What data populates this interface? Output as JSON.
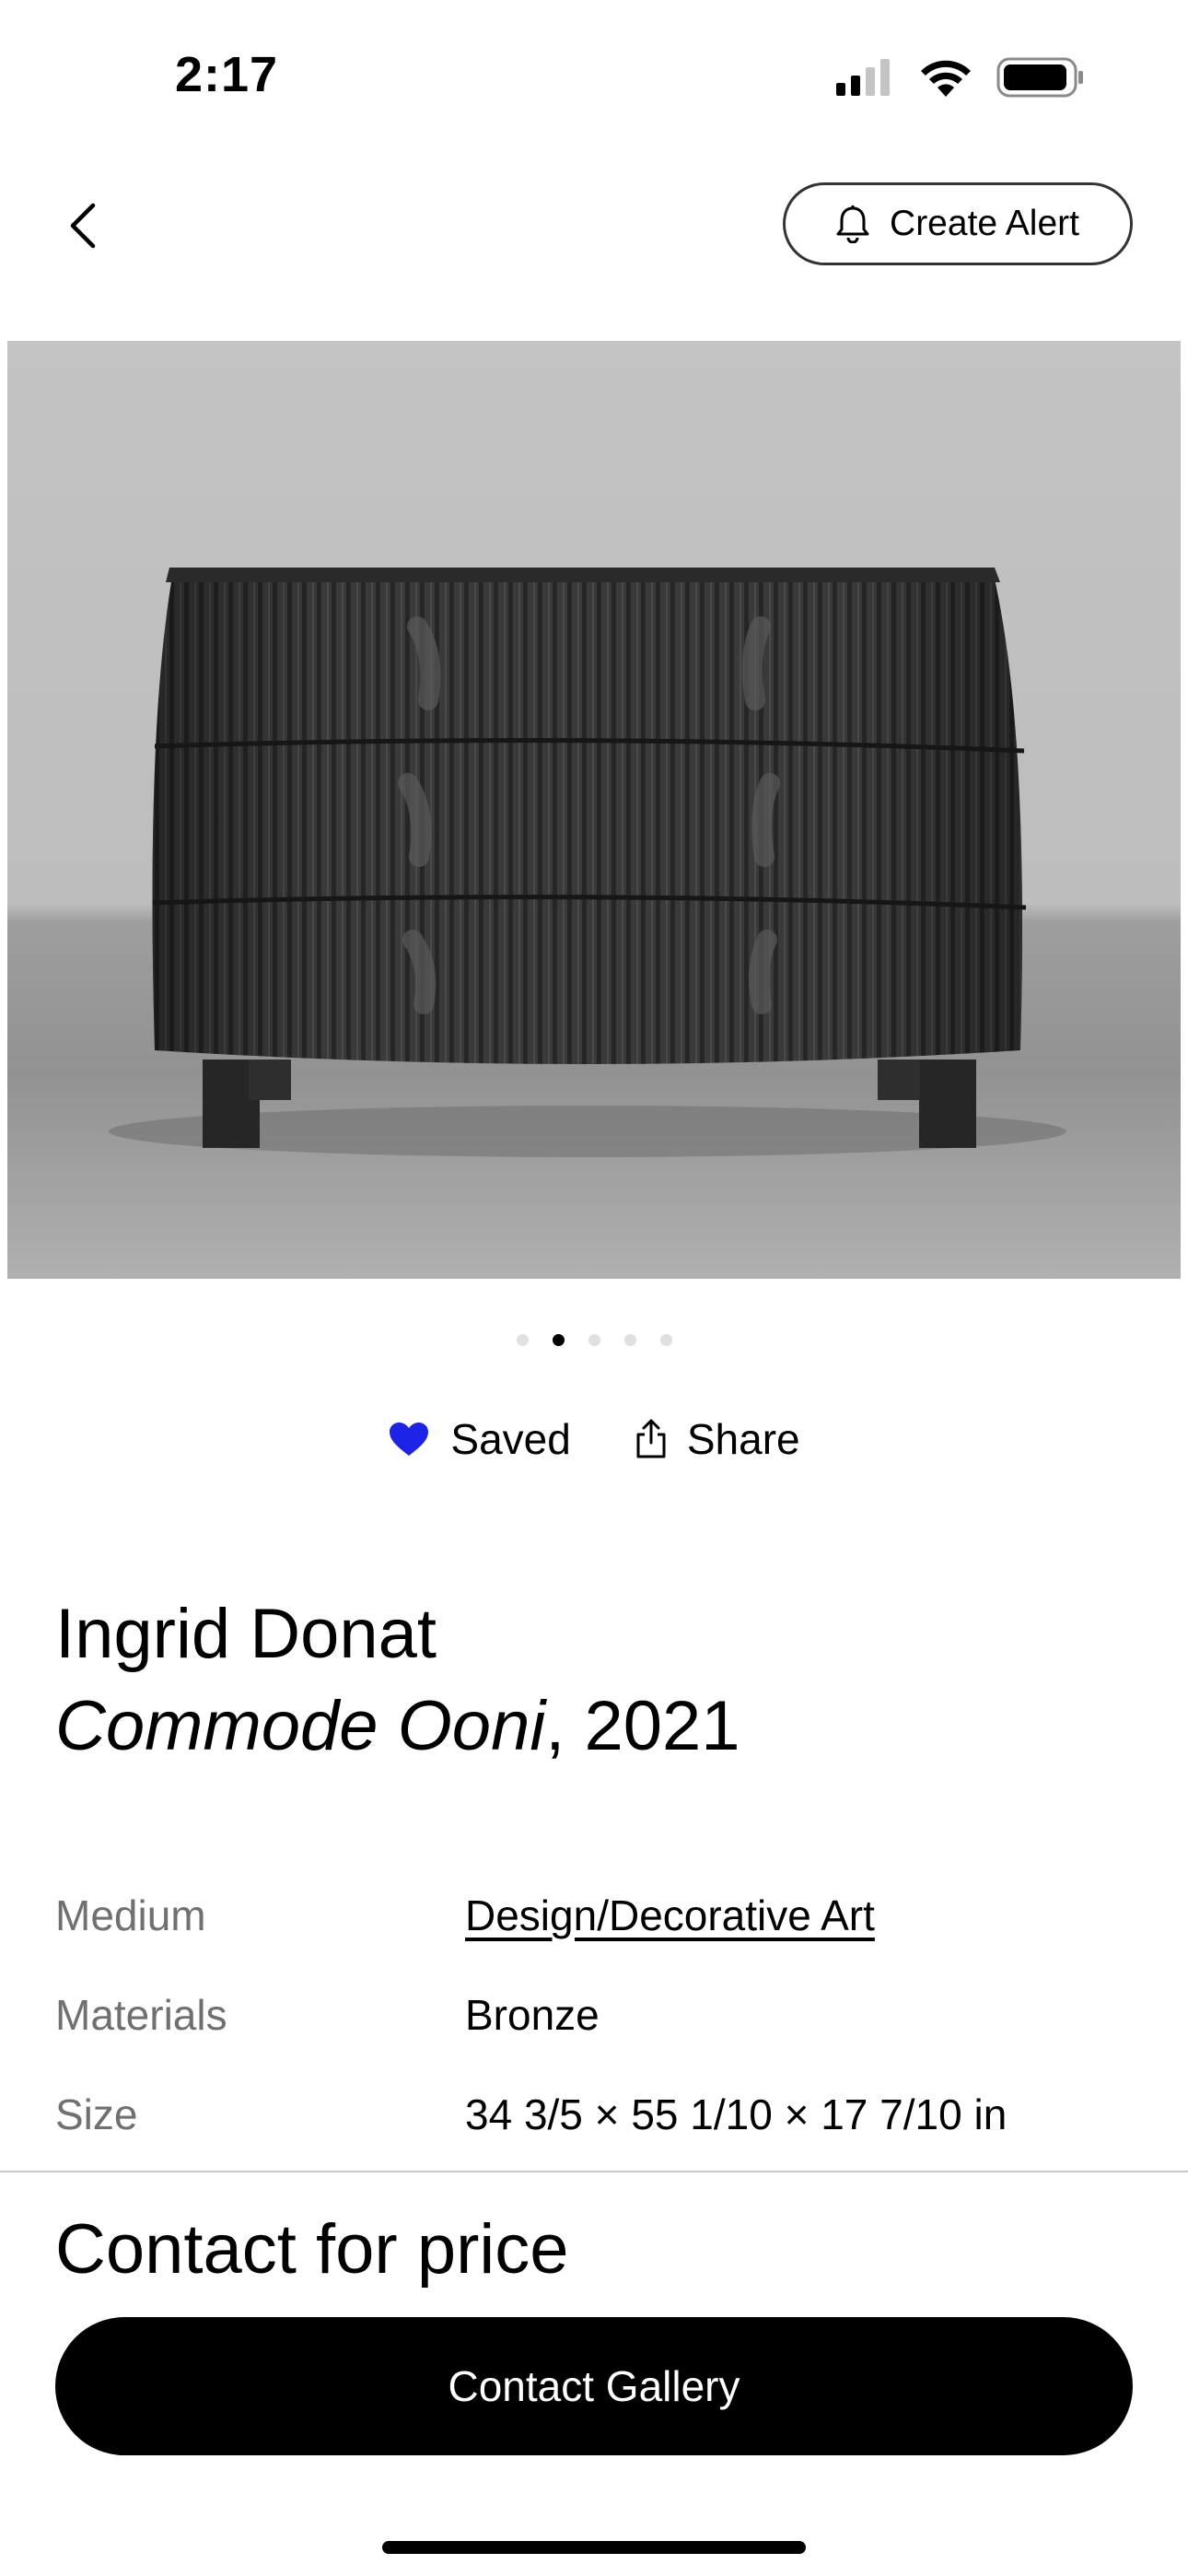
{
  "status_bar": {
    "time": "2:17"
  },
  "header": {
    "create_alert_label": "Create Alert"
  },
  "gallery": {
    "image_count": 5,
    "active_index": 1
  },
  "actions": {
    "saved_label": "Saved",
    "share_label": "Share"
  },
  "artwork": {
    "artist": "Ingrid Donat",
    "title": "Commode Ooni",
    "year_suffix": ", 2021"
  },
  "specs": [
    {
      "label": "Medium",
      "value": "Design/Decorative Art"
    },
    {
      "label": "Materials",
      "value": "Bronze"
    },
    {
      "label": "Size",
      "value": "34 3/5 × 55 1/10 × 17 7/10 in"
    }
  ],
  "footer": {
    "price_label": "Contact for price",
    "contact_button_label": "Contact Gallery"
  },
  "colors": {
    "saved_heart": "#1c22e6",
    "accent_black": "#000000"
  }
}
